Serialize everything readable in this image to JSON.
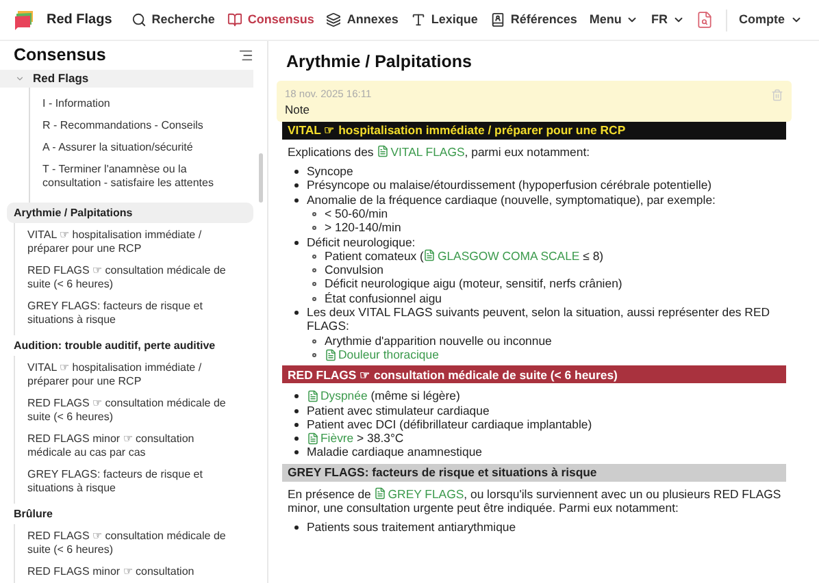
{
  "nav": {
    "brand": "Red Flags",
    "items": [
      {
        "label": "Recherche",
        "kind": "link",
        "selected": false
      },
      {
        "label": "Consensus",
        "kind": "link",
        "selected": true
      },
      {
        "label": "Annexes",
        "kind": "link",
        "selected": false
      },
      {
        "label": "Lexique",
        "kind": "link",
        "selected": false
      },
      {
        "label": "Références",
        "kind": "link",
        "selected": false
      },
      {
        "label": "Menu",
        "kind": "dropdown",
        "selected": false
      }
    ],
    "language": "FR",
    "account": "Compte"
  },
  "sidebar": {
    "title": "Consensus",
    "groups": [
      {
        "label": "Red Flags",
        "kind": "folder",
        "expanded": true,
        "selected": false,
        "children": [
          "I - Information",
          "R - Recommandations - Conseils",
          "A - Assurer la situation/sécurité",
          "T - Terminer l'anamnèse ou la consultation - satisfaire les attentes"
        ]
      },
      {
        "label": "Arythmie / Palpitations",
        "kind": "topic",
        "selected": true,
        "children": [
          "VITAL ☞ hospitalisation immédiate / préparer pour une RCP",
          "RED FLAGS ☞ consultation médicale de suite (< 6 heures)",
          "GREY FLAGS: facteurs de risque et situations à risque"
        ]
      },
      {
        "label": "Audition: trouble auditif, perte auditive",
        "kind": "topic",
        "selected": false,
        "children": [
          "VITAL ☞ hospitalisation immédiate / préparer pour une RCP",
          "RED FLAGS ☞ consultation médicale de suite (< 6 heures)",
          "RED FLAGS minor ☞ consultation médicale au cas par cas",
          "GREY FLAGS: facteurs de risque et situations à risque"
        ]
      },
      {
        "label": "Brûlure",
        "kind": "topic",
        "selected": false,
        "children": [
          "RED FLAGS ☞ consultation médicale de suite (< 6 heures)",
          "RED FLAGS minor ☞ consultation"
        ]
      }
    ]
  },
  "main": {
    "title": "Arythmie / Palpitations",
    "note": {
      "date": "18 nov. 2025 16:11",
      "text": "Note"
    },
    "sections": [
      {
        "kind": "vital",
        "title": "VITAL ☞ hospitalisation immédiate / préparer pour une RCP",
        "blocks": [
          {
            "kind": "paragraph",
            "parts": [
              {
                "text": "Explications des ",
                "kind": "text"
              },
              {
                "text": "VITAL FLAGS",
                "kind": "link"
              },
              {
                "text": ", parmi eux notamment:",
                "kind": "text"
              }
            ]
          },
          {
            "kind": "list",
            "items": [
              {
                "text": "Syncope"
              },
              {
                "text": "Présyncope ou malaise/étourdissement (hypoperfusion cérébrale potentielle)"
              },
              {
                "text": "Anomalie de la fréquence cardiaque (nouvelle, symptomatique), par exemple:",
                "children": [
                  {
                    "text": "< 50-60/min"
                  },
                  {
                    "text": "> 120-140/min"
                  }
                ]
              },
              {
                "text": "Déficit neurologique:",
                "children": [
                  {
                    "parts": [
                      {
                        "text": "Patient comateux (",
                        "kind": "text"
                      },
                      {
                        "text": "GLASGOW COMA SCALE",
                        "kind": "link"
                      },
                      {
                        "text": " ≤ 8)",
                        "kind": "text"
                      }
                    ]
                  },
                  {
                    "text": "Convulsion"
                  },
                  {
                    "text": "Déficit neurologique aigu (moteur, sensitif, nerfs crânien)"
                  },
                  {
                    "text": "État confusionnel aigu"
                  }
                ]
              },
              {
                "text": "Les deux VITAL FLAGS suivants peuvent, selon la situation, aussi représenter des RED FLAGS:",
                "children": [
                  {
                    "text": "Arythmie d'apparition nouvelle ou inconnue"
                  },
                  {
                    "parts": [
                      {
                        "text": "Douleur thoracique",
                        "kind": "link"
                      }
                    ]
                  }
                ]
              }
            ]
          }
        ]
      },
      {
        "kind": "red",
        "title": "RED FLAGS ☞ consultation médicale de suite (< 6 heures)",
        "blocks": [
          {
            "kind": "list",
            "items": [
              {
                "parts": [
                  {
                    "text": "Dyspnée",
                    "kind": "link"
                  },
                  {
                    "text": " (même si légère)",
                    "kind": "text"
                  }
                ]
              },
              {
                "text": "Patient avec stimulateur cardiaque"
              },
              {
                "text": "Patient avec DCI (défibrillateur cardiaque implantable)"
              },
              {
                "parts": [
                  {
                    "text": "Fièvre",
                    "kind": "link"
                  },
                  {
                    "text": " > 38.3°C",
                    "kind": "text"
                  }
                ]
              },
              {
                "text": "Maladie cardiaque anamnestique"
              }
            ]
          }
        ]
      },
      {
        "kind": "grey",
        "title": "GREY FLAGS: facteurs de risque et situations à risque",
        "blocks": [
          {
            "kind": "paragraph",
            "parts": [
              {
                "text": "En présence de ",
                "kind": "text"
              },
              {
                "text": "GREY FLAGS",
                "kind": "link"
              },
              {
                "text": ", ou lorsqu'ils surviennent avec un ou plusieurs RED FLAGS minor, une consultation urgente peut être indiquée. Parmi eux notamment:",
                "kind": "text"
              }
            ]
          },
          {
            "kind": "list",
            "items": [
              {
                "text": "Patients sous traitement antiarythmique"
              }
            ]
          }
        ]
      }
    ]
  }
}
